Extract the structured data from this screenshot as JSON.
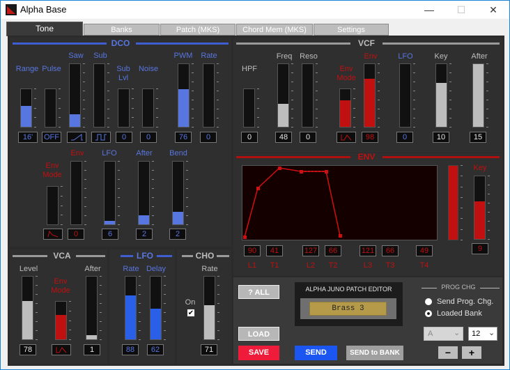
{
  "window": {
    "title": "Alpha Base",
    "min": "—",
    "max": "☐",
    "close": "✕"
  },
  "tabs": [
    "Tone",
    "Banks",
    "Patch (MKS)",
    "Chord Mem (MKS)",
    "Settings"
  ],
  "dco": {
    "title": "DCO",
    "labels": {
      "range": "Range",
      "pulse": "Pulse",
      "saw": "Saw",
      "sub": "Sub",
      "sub_lvl_1": "Sub",
      "sub_lvl_2": "Lvl",
      "noise": "Noise",
      "pwm": "PWM",
      "rate": "Rate",
      "env_mode_1": "Env",
      "env_mode_2": "Mode",
      "env": "Env",
      "lfo": "LFO",
      "after": "After",
      "bend": "Bend"
    },
    "values": {
      "range": "16'",
      "pulse": "OFF",
      "sub": "0",
      "noise": "0",
      "pwm": "76",
      "rate": "0",
      "env": "0",
      "lfo": "6",
      "after": "2",
      "bend": "2"
    },
    "levels": {
      "range": 0.55,
      "pulse": 0,
      "saw": 0.2,
      "sub": 0,
      "sub_lvl": 0,
      "noise": 0,
      "pwm": 0.6,
      "rate": 0,
      "env_mode": 0,
      "env": 0,
      "lfo": 0.06,
      "after": 0.15,
      "bend": 0.2
    }
  },
  "vcf": {
    "title": "VCF",
    "labels": {
      "hpf": "HPF",
      "freq": "Freq",
      "reso": "Reso",
      "env_mode_1": "Env",
      "env_mode_2": "Mode",
      "env": "Env",
      "lfo": "LFO",
      "key": "Key",
      "after": "After"
    },
    "values": {
      "hpf": "0",
      "freq": "48",
      "reso": "0",
      "env": "98",
      "lfo": "0",
      "key": "10",
      "after": "15"
    },
    "levels": {
      "hpf": 0,
      "freq": 0.37,
      "reso": 0,
      "env_mode": 0.7,
      "env": 0.77,
      "lfo": 0,
      "key": 0.7,
      "after": 1.0
    }
  },
  "env": {
    "title": "ENV",
    "key_label": "Key",
    "key_value": "9",
    "key_level": 0.6,
    "level_fill": 1.0,
    "params": [
      {
        "label": "L1",
        "value": "90"
      },
      {
        "label": "T1",
        "value": "41"
      },
      {
        "label": "L2",
        "value": "127"
      },
      {
        "label": "T2",
        "value": "66"
      },
      {
        "label": "L3",
        "value": "121"
      },
      {
        "label": "T3",
        "value": "66"
      },
      {
        "label": "T4",
        "value": "49"
      }
    ]
  },
  "vca": {
    "title": "VCA",
    "labels": {
      "level": "Level",
      "env_mode_1": "Env",
      "env_mode_2": "Mode",
      "after": "After"
    },
    "values": {
      "level": "78",
      "after": "1"
    },
    "levels": {
      "level": 0.61,
      "env_mode": 0.65,
      "after": 0.07
    }
  },
  "lfo": {
    "title": "LFO",
    "labels": {
      "rate": "Rate",
      "delay": "Delay"
    },
    "values": {
      "rate": "88",
      "delay": "62"
    },
    "levels": {
      "rate": 0.7,
      "delay": 0.49
    }
  },
  "cho": {
    "title": "CHO",
    "labels": {
      "on": "On",
      "rate": "Rate"
    },
    "values": {
      "rate": "71"
    },
    "levels": {
      "rate": 0.55
    },
    "checkbox": "✔"
  },
  "buttons": {
    "all": "? ALL",
    "load": "LOAD",
    "save": "SAVE",
    "send": "SEND",
    "send_to_bank": "SEND to BANK",
    "minus": "−",
    "plus": "+"
  },
  "patch_editor": {
    "title": "ALPHA JUNO PATCH EDITOR",
    "patch_name": "Brass 3"
  },
  "prog_chg": {
    "title": "PROG CHG",
    "option1": "Send Prog. Chg.",
    "option2": "Loaded Bank",
    "bank_letter": "A",
    "bank_number": "12"
  },
  "colors": {
    "blue": "#3f5ed2",
    "red": "#b01010",
    "grey": "#9a9a9a"
  }
}
